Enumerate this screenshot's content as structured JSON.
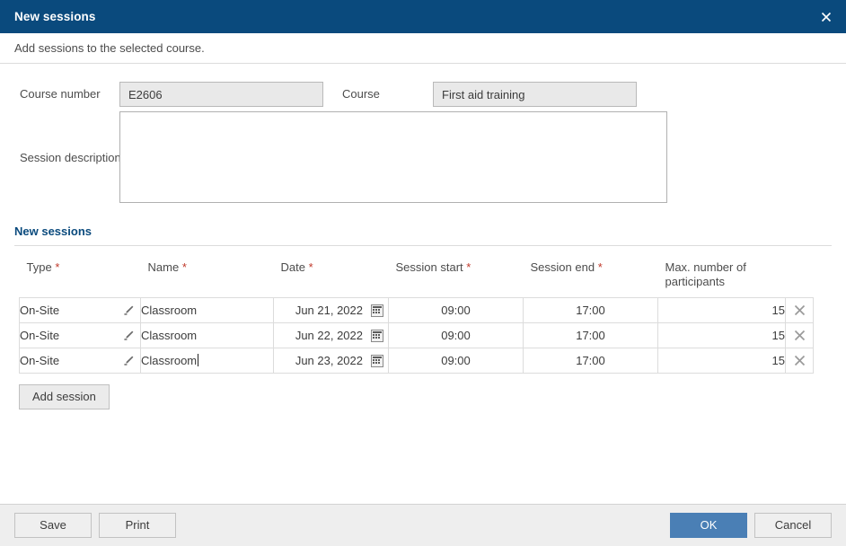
{
  "dialog": {
    "title": "New sessions",
    "close_icon": "close-icon",
    "subtitle": "Add sessions to the selected course."
  },
  "form": {
    "course_number": {
      "label": "Course number",
      "value": "E2606"
    },
    "course": {
      "label": "Course",
      "value": "First aid training"
    },
    "session_description": {
      "label": "Session description",
      "value": "",
      "placeholder": ""
    }
  },
  "sessions_section": {
    "title": "New sessions",
    "columns": [
      {
        "label": "Type",
        "required": true
      },
      {
        "label": "Name",
        "required": true
      },
      {
        "label": "Date",
        "required": true
      },
      {
        "label": "Session start",
        "required": true
      },
      {
        "label": "Session end",
        "required": true
      },
      {
        "label": "Max. number of participants",
        "required": false
      }
    ],
    "rows": [
      {
        "type": "On-Site",
        "name": "Classroom",
        "date": "Jun 21, 2022",
        "session_start": "09:00",
        "session_end": "17:00",
        "max_participants": "15",
        "edit_icon": "pencil-icon",
        "calendar_icon": "calendar-icon",
        "remove_icon": "close-icon"
      },
      {
        "type": "On-Site",
        "name": "Classroom",
        "date": "Jun 22, 2022",
        "session_start": "09:00",
        "session_end": "17:00",
        "max_participants": "15",
        "edit_icon": "pencil-icon",
        "calendar_icon": "calendar-icon",
        "remove_icon": "close-icon"
      },
      {
        "type": "On-Site",
        "name": "Classroom",
        "date": "Jun 23, 2022",
        "session_start": "09:00",
        "session_end": "17:00",
        "max_participants": "15",
        "edit_icon": "pencil-icon",
        "calendar_icon": "calendar-icon",
        "remove_icon": "close-icon"
      }
    ],
    "add_session_label": "Add session"
  },
  "footer": {
    "save_label": "Save",
    "print_label": "Print",
    "ok_label": "OK",
    "cancel_label": "Cancel"
  },
  "colors": {
    "titlebar": "#0a4a7d",
    "accent": "#0a4a7d",
    "primary_button": "#4a7fb5",
    "required_marker": "#c0392b",
    "footer_bg": "#eeeeee"
  }
}
